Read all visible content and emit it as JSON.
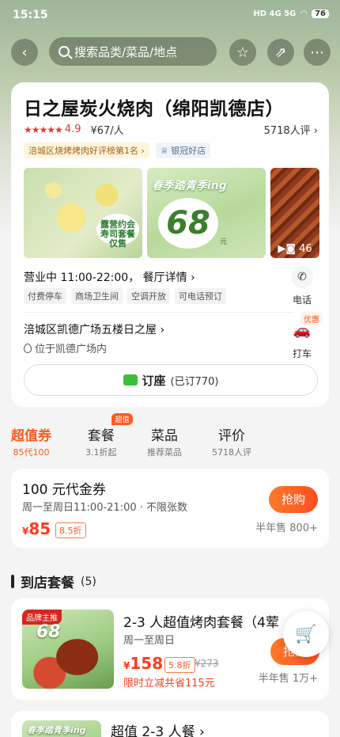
{
  "status": {
    "time": "15:15",
    "network": "HD 4G 5G",
    "battery": "76"
  },
  "nav": {
    "search_placeholder": "搜索品类/菜品/地点"
  },
  "store": {
    "name": "日之屋炭火烧肉（绵阳凯德店）",
    "stars": "★★★★★",
    "score": "4.9",
    "avg_price": "¥67/人",
    "reviews": "5718人评 ›",
    "rank_tag": "涪城区烧烤烤肉好评榜第1名 ›",
    "silver_tag": "银冠好店",
    "photo_count": "46",
    "photo1_text": "露营约会\n寿司套餐仅售",
    "photo2_banner": "春季踏青季ing",
    "photo2_price": "68",
    "photo2_unit": "元",
    "hours": "营业中 11:00-22:00， 餐厅详情 ›",
    "facilities": [
      "付费停车",
      "商场卫生间",
      "空调开放",
      "可电话预订"
    ],
    "phone_label": "电话",
    "address": "涪城区凯德广场五楼日之屋 ›",
    "address_sub": "位于凯德广场内",
    "taxi_label": "打车",
    "taxi_badge": "优惠",
    "reserve_label": "订座",
    "reserve_count": "(已订770)"
  },
  "tabs": [
    {
      "title": "超值券",
      "sub": "85代100",
      "active": true
    },
    {
      "title": "套餐",
      "sub": "3.1折起",
      "badge": "超值"
    },
    {
      "title": "菜品",
      "sub": "推荐菜品"
    },
    {
      "title": "评价",
      "sub": "5718人评"
    }
  ],
  "coupon": {
    "name": "100 元代金券",
    "desc": "周一至周日11:00-21:00 · 不限张数",
    "currency": "¥",
    "price": "85",
    "discount": "8.5折",
    "button": "抢购",
    "sold": "半年售 800+"
  },
  "section": {
    "title": "到店套餐",
    "count": "(5)"
  },
  "package1": {
    "label": "品牌主推",
    "img_text": "68",
    "name": "2-3 人超值烤肉套餐（4荤",
    "days": "周一至周日",
    "currency": "¥",
    "price": "158",
    "discount": "5.8折",
    "orig": "¥273",
    "save": "限时立减共省115元",
    "button": "抢购",
    "sold": "半年售 1万+"
  },
  "package2": {
    "img_text": "春季踏青季ing",
    "name": "超值 2-3 人餐 ›"
  }
}
